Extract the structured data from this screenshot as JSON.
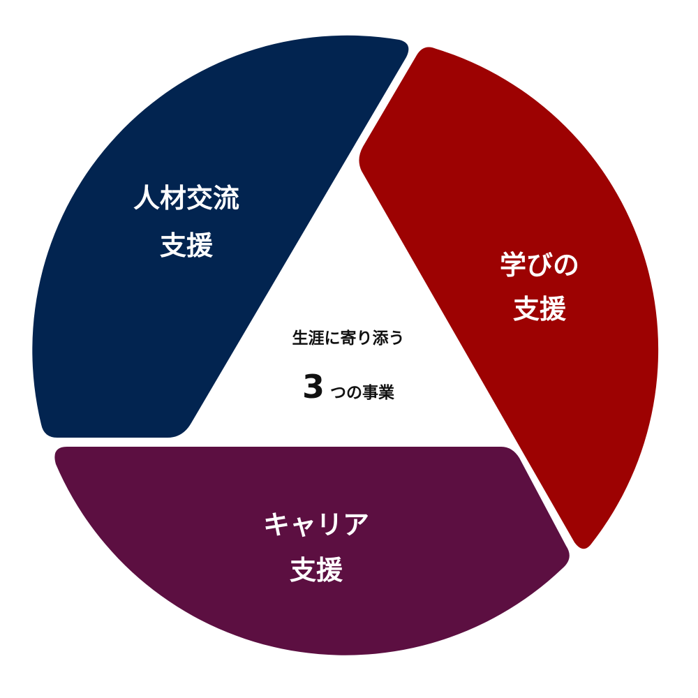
{
  "segments": {
    "jinzai": {
      "line1": "人材交流",
      "line2": "支援",
      "color": "#022450"
    },
    "manabi": {
      "line1": "学びの",
      "line2": "支援",
      "color": "#9d0202"
    },
    "career": {
      "line1": "キャリア",
      "line2": "支援",
      "color": "#5c0f41"
    }
  },
  "center": {
    "tagline": "生涯に寄り添う",
    "number": "3",
    "suffix": "つの事業",
    "color": "#111111"
  },
  "background": "#ffffff"
}
